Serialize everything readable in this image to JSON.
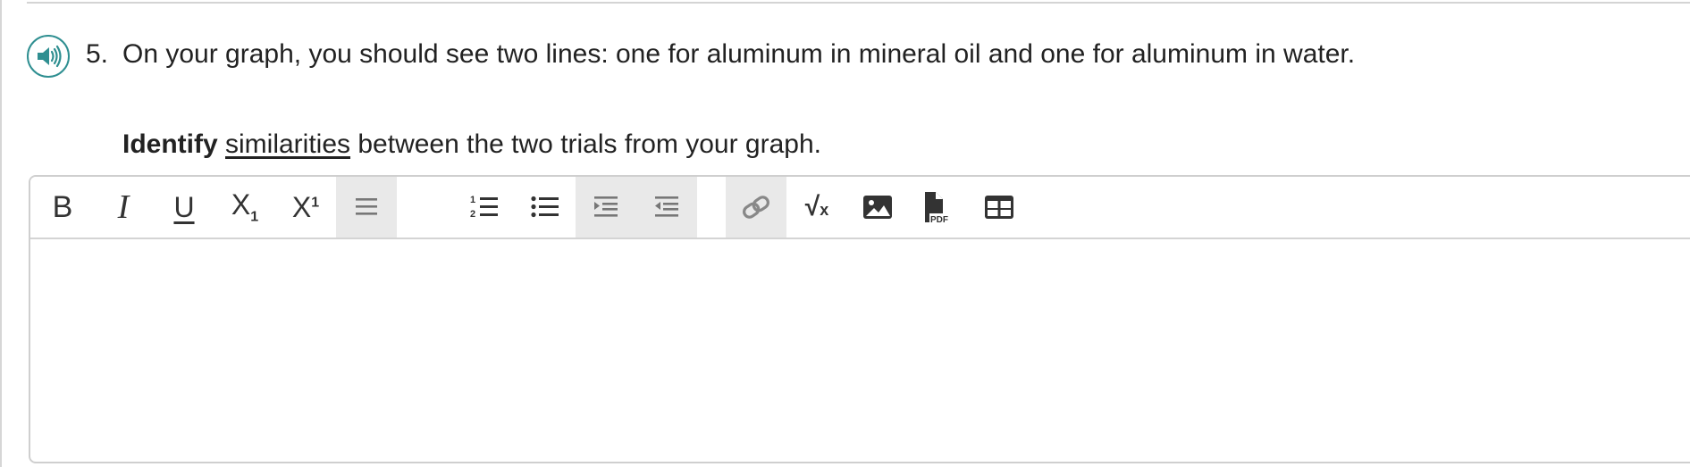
{
  "question": {
    "number": "5.",
    "text": "On your graph, you should see two lines: one for aluminum in mineral oil and one for aluminum in water.",
    "instruction_bold": "Identify",
    "instruction_underlined": "similarities",
    "instruction_rest": "between the two trials from your graph."
  },
  "toolbar": {
    "bold": "B",
    "italic": "I",
    "underline": "U",
    "subscript_base": "X",
    "subscript_mark": "1",
    "superscript_base": "X",
    "superscript_mark": "1",
    "sqrt_symbol": "√",
    "sqrt_x": "x",
    "pdf_label": "PDF",
    "icons": [
      "bold-icon",
      "italic-icon",
      "underline-icon",
      "subscript-icon",
      "superscript-icon",
      "align-icon",
      "numbered-list-icon",
      "bulleted-list-icon",
      "indent-icon",
      "outdent-icon",
      "link-icon",
      "equation-icon",
      "image-icon",
      "pdf-icon",
      "table-icon"
    ]
  },
  "editor": {
    "content": ""
  },
  "colors": {
    "accent": "#2f8f91",
    "toolbar_active_bg": "#e9e9e9",
    "border": "#cfcfcf"
  }
}
